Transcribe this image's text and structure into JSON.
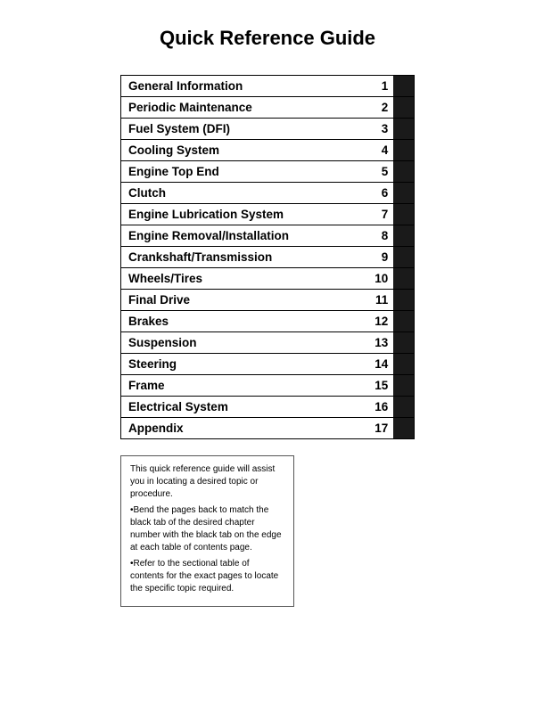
{
  "title": "Quick Reference Guide",
  "items": [
    {
      "label": "General Information",
      "num": "1"
    },
    {
      "label": "Periodic Maintenance",
      "num": "2"
    },
    {
      "label": "Fuel System (DFI)",
      "num": "3"
    },
    {
      "label": "Cooling System",
      "num": "4"
    },
    {
      "label": "Engine Top End",
      "num": "5"
    },
    {
      "label": "Clutch",
      "num": "6"
    },
    {
      "label": "Engine Lubrication System",
      "num": "7"
    },
    {
      "label": "Engine Removal/Installation",
      "num": "8"
    },
    {
      "label": "Crankshaft/Transmission",
      "num": "9"
    },
    {
      "label": "Wheels/Tires",
      "num": "10"
    },
    {
      "label": "Final Drive",
      "num": "11"
    },
    {
      "label": "Brakes",
      "num": "12"
    },
    {
      "label": "Suspension",
      "num": "13"
    },
    {
      "label": "Steering",
      "num": "14"
    },
    {
      "label": "Frame",
      "num": "15"
    },
    {
      "label": "Electrical System",
      "num": "16"
    },
    {
      "label": "Appendix",
      "num": "17"
    }
  ],
  "info_box": {
    "line1": "This quick reference guide will assist you in locating a desired topic or procedure.",
    "line2": "•Bend the pages back to match the black tab of the desired chapter number with the black tab on the edge at each table of contents page.",
    "line3": "•Refer to the sectional table of contents for the exact pages to locate the specific topic required."
  }
}
